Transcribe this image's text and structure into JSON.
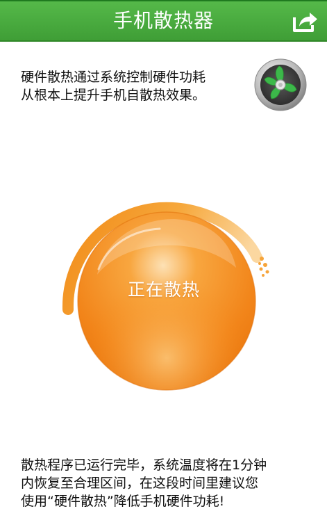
{
  "app": {
    "title": "手机散热器",
    "share_icon": "share-icon",
    "fan_icon": "fan-icon"
  },
  "intro": {
    "lines": [
      "硬件散热通过系统控制硬件功耗",
      "从根本上提升手机自散热效果。"
    ]
  },
  "cooling": {
    "status_label": "正在散热"
  },
  "message": {
    "lines": [
      "散热程序已运行完毕，系统温度将在1分钟",
      "内恢复至合理区间，在这段时间里建议您",
      "使用“硬件散热”降低手机硬件功耗!"
    ]
  },
  "colors": {
    "header_green": "#4caf43",
    "orb_orange": "#f7901e",
    "fan_green": "#3cb84a"
  }
}
